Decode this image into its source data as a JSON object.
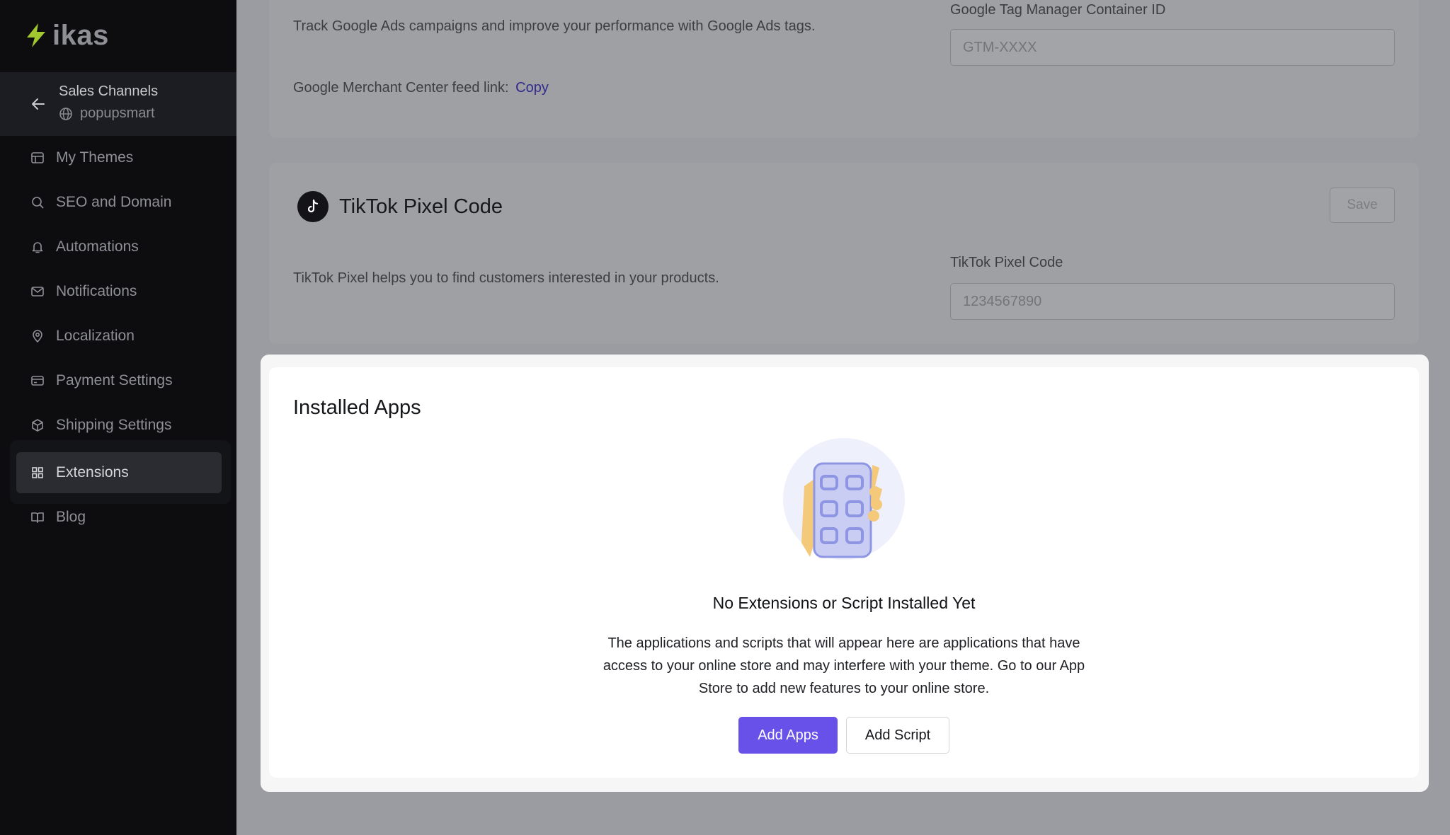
{
  "brand": {
    "name": "ikas",
    "accent": "#a3c72f"
  },
  "sidebar": {
    "channel": {
      "title": "Sales Channels",
      "store": "popupsmart"
    },
    "items": [
      {
        "label": "My Themes",
        "icon": "layout-icon"
      },
      {
        "label": "SEO and Domain",
        "icon": "search-icon"
      },
      {
        "label": "Automations",
        "icon": "bell-icon"
      },
      {
        "label": "Notifications",
        "icon": "mail-icon"
      },
      {
        "label": "Localization",
        "icon": "location-pin-icon"
      },
      {
        "label": "Payment Settings",
        "icon": "credit-card-icon"
      },
      {
        "label": "Shipping Settings",
        "icon": "package-icon"
      },
      {
        "label": "Extensions",
        "icon": "grid-icon",
        "active": true
      },
      {
        "label": "Blog",
        "icon": "book-icon"
      }
    ]
  },
  "google_ads": {
    "description": "Track Google Ads campaigns and improve your performance with Google Ads tags.",
    "feed_label": "Google Merchant Center feed link:",
    "copy_label": "Copy",
    "gtm_label": "Google Tag Manager Container ID",
    "gtm_placeholder": "GTM-XXXX"
  },
  "tiktok": {
    "title": "TikTok Pixel Code",
    "save_label": "Save",
    "description": "TikTok Pixel helps you to find customers interested in your products.",
    "field_label": "TikTok Pixel Code",
    "field_placeholder": "1234567890"
  },
  "installed_apps": {
    "title": "Installed Apps",
    "empty_title": "No Extensions or Script Installed Yet",
    "empty_description": "The applications and scripts that will appear here are applications that have access to your online store and may interfere with your theme. Go to our App Store to add new features to your online store.",
    "add_apps_label": "Add Apps",
    "add_script_label": "Add Script",
    "primary_color": "#6851e8"
  }
}
